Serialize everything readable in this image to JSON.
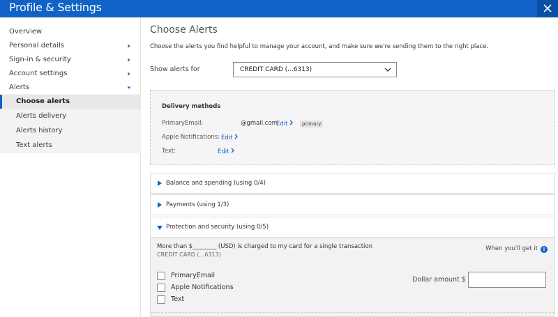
{
  "header": {
    "title": "Profile & Settings"
  },
  "sidebar": {
    "items": [
      {
        "label": "Overview"
      },
      {
        "label": "Personal details"
      },
      {
        "label": "Sign-in & security"
      },
      {
        "label": "Account settings"
      },
      {
        "label": "Alerts"
      }
    ],
    "sub_items": [
      {
        "label": "Choose alerts"
      },
      {
        "label": "Alerts delivery"
      },
      {
        "label": "Alerts history"
      },
      {
        "label": "Text alerts"
      }
    ]
  },
  "main": {
    "title": "Choose Alerts",
    "intro": "Choose the alerts you find helpful to manage your account, and make sure we're sending them to the right place.",
    "show_label": "Show alerts for",
    "select_value": "CREDIT CARD (...6313)",
    "delivery": {
      "title": "Delivery methods",
      "rows": [
        {
          "label": "PrimaryEmail:",
          "value": "@gmail.com",
          "edit": "Edit",
          "badge": "primary"
        },
        {
          "label": "Apple Notifications:",
          "edit": "Edit"
        },
        {
          "label": "Text:",
          "edit": "Edit"
        }
      ]
    },
    "accordions": [
      {
        "label": "Balance and spending (using 0/4)",
        "expanded": false
      },
      {
        "label": "Payments (using 1/3)",
        "expanded": false
      },
      {
        "label": "Protection and security (using 0/5)",
        "expanded": true
      }
    ],
    "rule": {
      "text": "More than $________ (USD) is charged to my card for a single transaction",
      "account": "CREDIT CARD (...6313)",
      "when_label": "When you'll get it",
      "checkboxes": [
        {
          "label": "PrimaryEmail",
          "checked": false
        },
        {
          "label": "Apple Notifications",
          "checked": false
        },
        {
          "label": "Text",
          "checked": false
        }
      ],
      "dollar_label": "Dollar amount $",
      "dollar_value": ""
    }
  },
  "colors": {
    "brand": "#1062c6",
    "panel": "#f3f3f3"
  }
}
